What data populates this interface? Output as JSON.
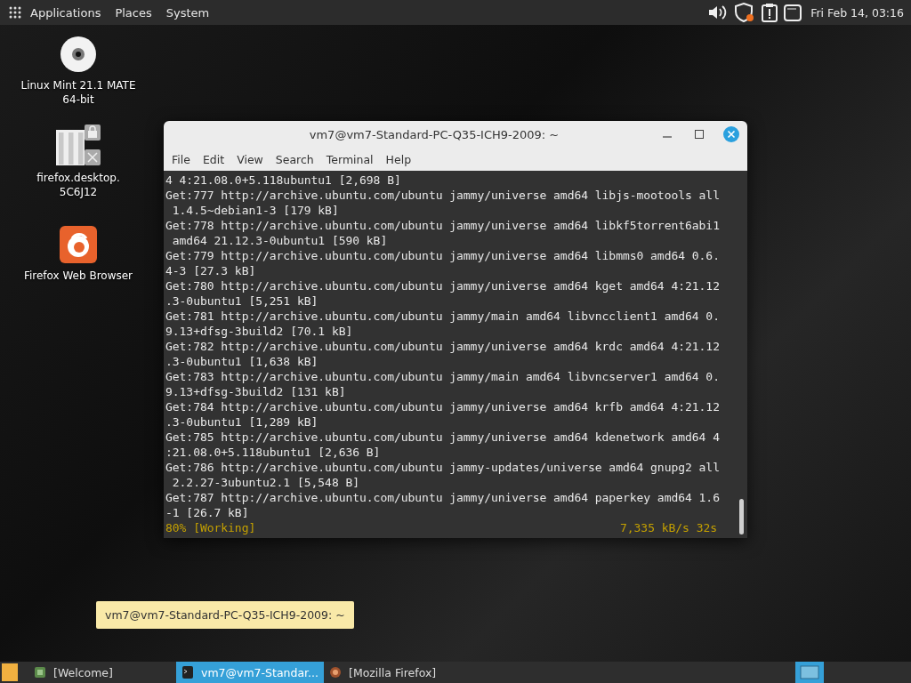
{
  "top_panel": {
    "menus": [
      "Applications",
      "Places",
      "System"
    ],
    "clock": "Fri Feb 14, 03:16"
  },
  "desktop_icons": [
    {
      "kind": "disc",
      "label": "Linux Mint 21.1 MATE 64-bit"
    },
    {
      "kind": "file",
      "label": "firefox.desktop. 5C6J12"
    },
    {
      "kind": "firefox",
      "label": "Firefox Web Browser"
    }
  ],
  "terminal": {
    "title": "vm7@vm7-Standard-PC-Q35-ICH9-2009: ~",
    "menu": [
      "File",
      "Edit",
      "View",
      "Search",
      "Terminal",
      "Help"
    ],
    "lines": [
      "4 4:21.08.0+5.118ubuntu1 [2,698 B]",
      "Get:777 http://archive.ubuntu.com/ubuntu jammy/universe amd64 libjs-mootools all",
      " 1.4.5~debian1-3 [179 kB]",
      "Get:778 http://archive.ubuntu.com/ubuntu jammy/universe amd64 libkf5torrent6abi1",
      " amd64 21.12.3-0ubuntu1 [590 kB]",
      "Get:779 http://archive.ubuntu.com/ubuntu jammy/universe amd64 libmms0 amd64 0.6.",
      "4-3 [27.3 kB]",
      "Get:780 http://archive.ubuntu.com/ubuntu jammy/universe amd64 kget amd64 4:21.12",
      ".3-0ubuntu1 [5,251 kB]",
      "Get:781 http://archive.ubuntu.com/ubuntu jammy/main amd64 libvncclient1 amd64 0.",
      "9.13+dfsg-3build2 [70.1 kB]",
      "Get:782 http://archive.ubuntu.com/ubuntu jammy/universe amd64 krdc amd64 4:21.12",
      ".3-0ubuntu1 [1,638 kB]",
      "Get:783 http://archive.ubuntu.com/ubuntu jammy/main amd64 libvncserver1 amd64 0.",
      "9.13+dfsg-3build2 [131 kB]",
      "Get:784 http://archive.ubuntu.com/ubuntu jammy/universe amd64 krfb amd64 4:21.12",
      ".3-0ubuntu1 [1,289 kB]",
      "Get:785 http://archive.ubuntu.com/ubuntu jammy/universe amd64 kdenetwork amd64 4",
      ":21.08.0+5.118ubuntu1 [2,636 B]",
      "Get:786 http://archive.ubuntu.com/ubuntu jammy-updates/universe amd64 gnupg2 all",
      " 2.2.27-3ubuntu2.1 [5,548 B]",
      "Get:787 http://archive.ubuntu.com/ubuntu jammy/universe amd64 paperkey amd64 1.6",
      "-1 [26.7 kB]"
    ],
    "progress": "80% [Working]",
    "speed": "7,335 kB/s 32s"
  },
  "tooltip": "vm7@vm7-Standard-PC-Q35-ICH9-2009: ~",
  "taskbar": {
    "items": [
      {
        "kind": "welcome",
        "label": "[Welcome]",
        "selected": false
      },
      {
        "kind": "terminal",
        "label": "vm7@vm7-Standar...",
        "selected": true
      },
      {
        "kind": "firefox",
        "label": "[Mozilla Firefox]",
        "selected": false
      }
    ]
  }
}
